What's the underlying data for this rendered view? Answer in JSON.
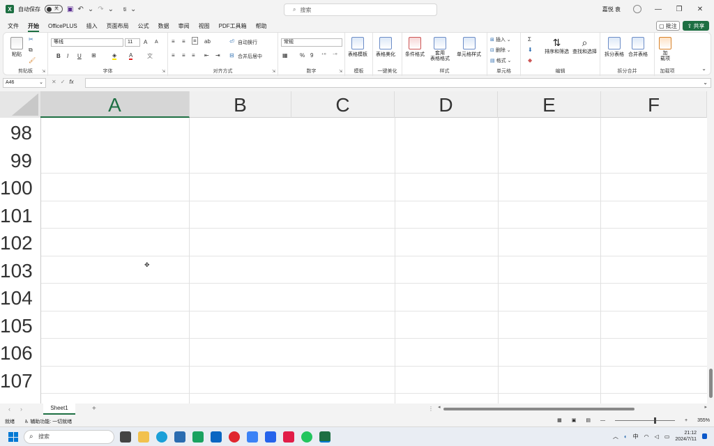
{
  "titlebar": {
    "autosave_label": "自动保存",
    "autosave_state": "关",
    "filename": "ti",
    "search_placeholder": "搜索",
    "user_name": "嘉悦 袁"
  },
  "menu": {
    "items": [
      "文件",
      "开始",
      "OfficePLUS",
      "插入",
      "页面布局",
      "公式",
      "数据",
      "审阅",
      "视图",
      "PDF工具箱",
      "帮助"
    ],
    "active": "开始",
    "comment_label": "批注",
    "share_label": "共享"
  },
  "ribbon": {
    "clipboard": {
      "paste": "粘贴",
      "label": "剪贴板"
    },
    "font": {
      "name": "等线",
      "size": "11",
      "label": "字体",
      "bold": "B",
      "italic": "I",
      "underline": "U",
      "grow": "A",
      "shrink": "A"
    },
    "alignment": {
      "wrap": "自动换行",
      "merge": "合并后居中",
      "label": "对齐方式"
    },
    "number": {
      "format": "常规",
      "label": "数字",
      "percent": "%",
      "comma": "9"
    },
    "template": {
      "btn": "表格模板",
      "label": "模板"
    },
    "beautify": {
      "btn": "表格美化",
      "label": "一键美化"
    },
    "styles": {
      "conditional": "条件格式",
      "table_fmt_1": "套用",
      "table_fmt_2": "表格格式",
      "cell_style": "单元格样式",
      "label": "样式"
    },
    "cells": {
      "insert": "插入",
      "delete": "删除",
      "format": "格式",
      "label": "单元格"
    },
    "editing": {
      "sum": "Σ",
      "sort": "排序和筛选",
      "find": "查找和选择",
      "label": "编辑"
    },
    "split": {
      "split": "拆分表格",
      "merge": "合并表格",
      "label": "拆分合并"
    },
    "addins": {
      "btn_1": "加",
      "btn_2": "载项",
      "label": "加载项"
    }
  },
  "formula_bar": {
    "name_box": "A46",
    "fx": "fx",
    "value": ""
  },
  "columns": [
    {
      "label": "A",
      "active": true
    },
    {
      "label": "B",
      "active": false
    },
    {
      "label": "C",
      "active": false
    },
    {
      "label": "D",
      "active": false
    },
    {
      "label": "E",
      "active": false
    },
    {
      "label": "F",
      "active": false
    }
  ],
  "rows": [
    "98",
    "99",
    "100",
    "101",
    "102",
    "103",
    "104",
    "105",
    "106",
    "107"
  ],
  "sheets": {
    "tab": "Sheet1",
    "add": "+"
  },
  "status": {
    "ready": "就绪",
    "accessibility": "辅助功能: 一切就绪",
    "zoom": "355%"
  },
  "taskbar": {
    "search": "搜索",
    "time": "21:12",
    "date": "2024/7/11",
    "lang": "中"
  },
  "colors": {
    "accent": "#1d6f42",
    "windows_blue": "#0078d4"
  }
}
